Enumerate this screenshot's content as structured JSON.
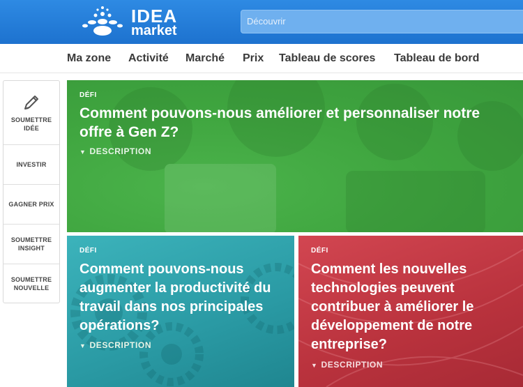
{
  "header": {
    "logo": {
      "line1": "IDEA",
      "line2": "market"
    },
    "search": {
      "placeholder": "Découvrir"
    }
  },
  "nav": {
    "items": [
      "Ma zone",
      "Activité",
      "Marché",
      "Prix",
      "Tableau de scores",
      "Tableau de bord"
    ]
  },
  "sidebar": {
    "items": [
      {
        "label_l1": "SOUMETTRE",
        "label_l2": "IDÉE",
        "icon": "pencil-icon"
      },
      {
        "label_l1": "INVESTIR",
        "label_l2": ""
      },
      {
        "label_l1": "GAGNER PRIX",
        "label_l2": ""
      },
      {
        "label_l1": "SOUMETTRE",
        "label_l2": "INSIGHT"
      },
      {
        "label_l1": "SOUMETTRE",
        "label_l2": "NOUVELLE"
      }
    ]
  },
  "cards": [
    {
      "tag": "DÉFI",
      "title": "Comment pouvons-nous améliorer et personnaliser notre offre à Gen Z?",
      "description": "DESCRIPTION",
      "color": "#3fa53f"
    },
    {
      "tag": "DÉFI",
      "title": "Comment pouvons-nous augmenter la productivité du travail dans nos principales opérations?",
      "description": "DESCRIPTION",
      "color": "#2a9aa4"
    },
    {
      "tag": "DÉFI",
      "title": "Comment les nouvelles technologies peuvent contribuer à améliorer le développement de notre entreprise?",
      "description": "DESCRIPTION",
      "color": "#b9323d"
    }
  ],
  "colors": {
    "header": "#1d72cf",
    "accent_green": "#3fa53f",
    "accent_teal": "#2a9aa4",
    "accent_red": "#b9323d"
  }
}
